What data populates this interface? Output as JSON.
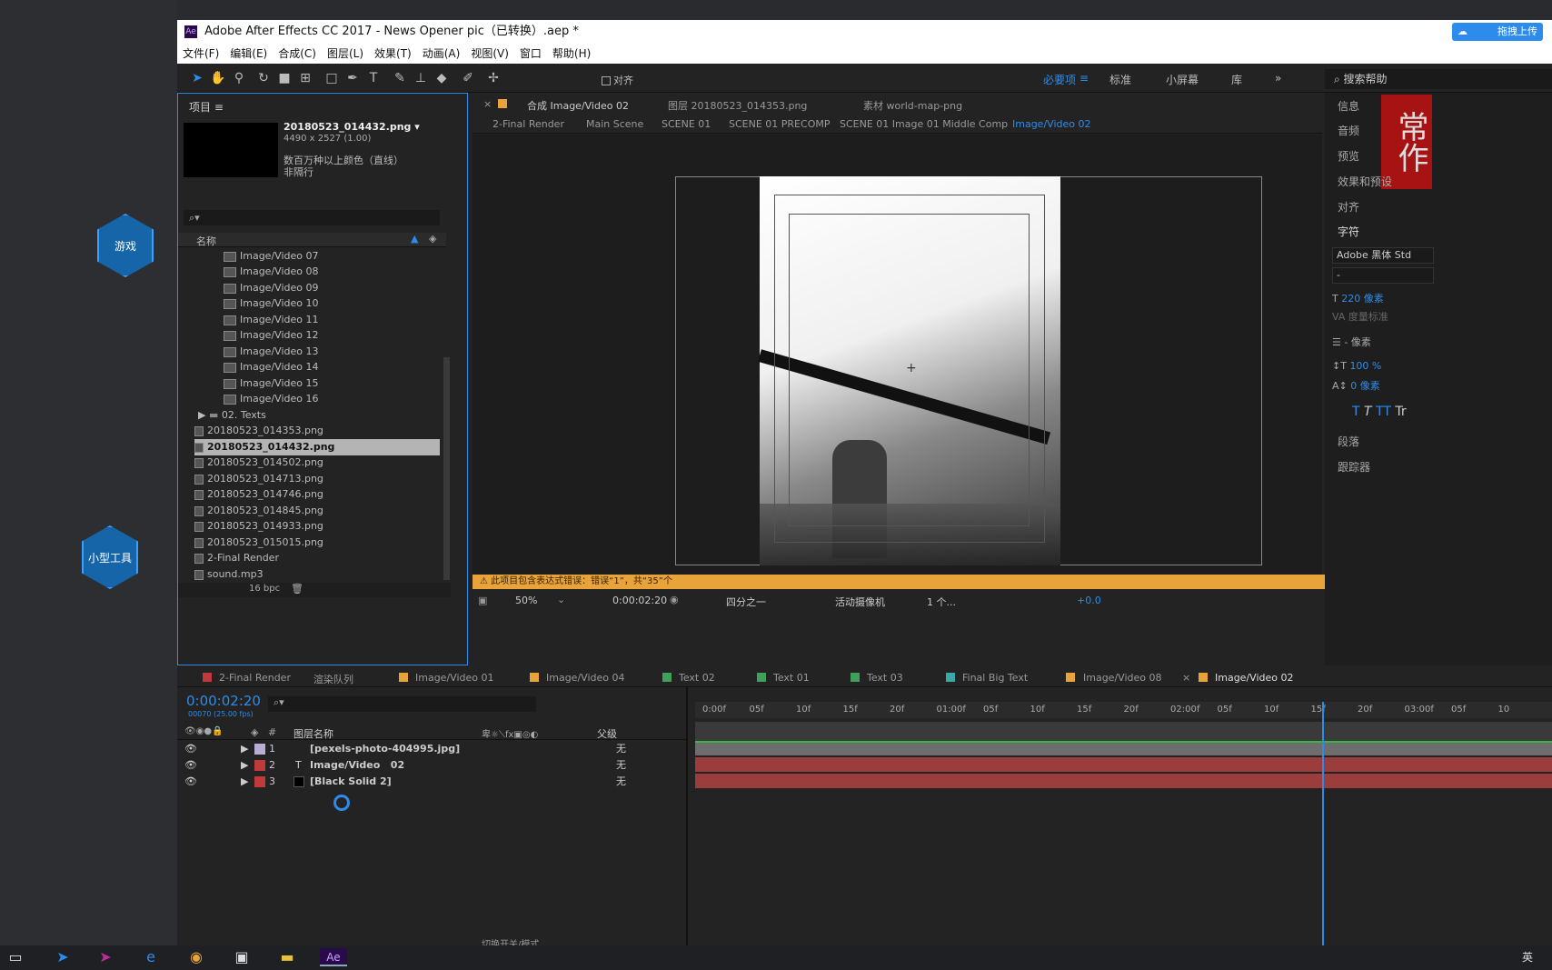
{
  "desktop": {
    "icons": [
      "游戏",
      "小型工具"
    ],
    "upload_button": "拖拽上传"
  },
  "window": {
    "title": "Adobe After Effects CC 2017 - News Opener pic（已转换）.aep *"
  },
  "menu": [
    "文件(F)",
    "编辑(E)",
    "合成(C)",
    "图层(L)",
    "效果(T)",
    "动画(A)",
    "视图(V)",
    "窗口",
    "帮助(H)"
  ],
  "toolbar": {
    "align": "对齐",
    "workspaces": [
      "必要项",
      "标准",
      "小屏幕",
      "库"
    ],
    "search_help": "搜索帮助"
  },
  "project": {
    "tab": "项目",
    "selected": {
      "name": "20180523_014432.png ▾",
      "size": "4490 x 2527 (1.00)",
      "desc1": "数百万种以上颜色（直线）",
      "desc2": "非隔行"
    },
    "col_name": "名称",
    "items": [
      "Image/Video 07",
      "Image/Video 08",
      "Image/Video 09",
      "Image/Video 10",
      "Image/Video 11",
      "Image/Video 12",
      "Image/Video 13",
      "Image/Video 14",
      "Image/Video 15",
      "Image/Video 16"
    ],
    "folder": "02. Texts",
    "files": [
      "20180523_014353.png",
      "20180523_014432.png",
      "20180523_014502.png",
      "20180523_014713.png",
      "20180523_014746.png",
      "20180523_014845.png",
      "20180523_014933.png",
      "20180523_015015.png",
      "2-Final Render",
      "sound.mp3"
    ],
    "bpc": "16 bpc"
  },
  "comp": {
    "tabs": [
      "合成 Image/Video 02",
      "图层 20180523_014353.png",
      "素材 world-map-png"
    ],
    "breadcrumbs": [
      "2-Final Render",
      "Main Scene",
      "SCENE 01",
      "SCENE 01 PRECOMP",
      "SCENE 01 Image 01 Middle Comp",
      "Image/Video 02"
    ],
    "warning": "此项目包含表达式错误：错误“1”，共“35”个",
    "zoom": "50%",
    "time": "0:00:02:20",
    "resolution": "四分之一",
    "camera": "活动摄像机",
    "views": "1 个...",
    "exposure": "+0.0"
  },
  "right": {
    "tabs": [
      "信息",
      "音频",
      "预览",
      "效果和预设",
      "对齐",
      "字符"
    ],
    "font": "Adobe 黑体 Std",
    "style": "-",
    "size": "220 像素",
    "kerning": "度量标准",
    "leading": "- 像素",
    "scale": "100 %",
    "baseline": "0 像素",
    "bottom_tabs": [
      "段落",
      "跟踪器"
    ],
    "logo": "常作"
  },
  "timeline": {
    "tabs": [
      "2-Final Render",
      "渲染队列",
      "Image/Video 01",
      "Image/Video 04",
      "Text 02",
      "Text 01",
      "Text 03",
      "Final Big Text",
      "Image/Video 08",
      "Image/Video 02"
    ],
    "time": "0:00:02:20",
    "subtime": "00070 (25.00 fps)",
    "col_layer": "图层名称",
    "col_parent": "父级",
    "layers": [
      {
        "num": "1",
        "name": "[pexels-photo-404995.jpg]",
        "parent": "无"
      },
      {
        "num": "2",
        "name": "Image/Video   02",
        "parent": "无"
      },
      {
        "num": "3",
        "name": "[Black Solid 2]",
        "parent": "无"
      }
    ],
    "ruler": [
      "0:00f",
      "05f",
      "10f",
      "15f",
      "20f",
      "01:00f",
      "05f",
      "10f",
      "15f",
      "20f",
      "02:00f",
      "05f",
      "10f",
      "15f",
      "20f",
      "03:00f",
      "05f",
      "10"
    ],
    "footer": "切换开关/模式"
  },
  "taskbar": {
    "tray": "英"
  }
}
